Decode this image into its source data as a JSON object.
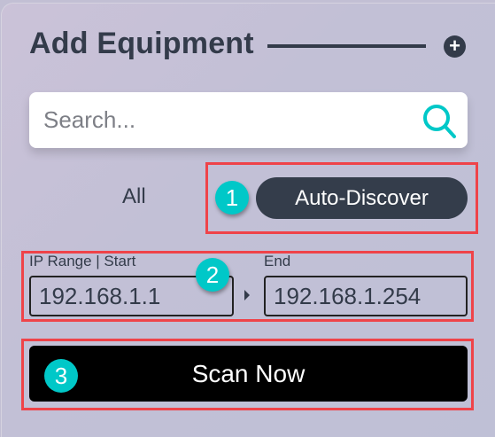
{
  "header": {
    "title": "Add Equipment",
    "add_icon": "plus-circle-icon"
  },
  "search": {
    "placeholder": "Search...",
    "icon": "search-icon",
    "accent": "#00c8c8"
  },
  "filters": {
    "all_label": "All",
    "auto_discover_label": "Auto-Discover"
  },
  "ip_range": {
    "start_label": "IP Range | Start",
    "start_value": "192.168.1.1",
    "end_label": "End",
    "end_value": "192.168.1.254"
  },
  "scan_button": {
    "label": "Scan Now"
  },
  "annotations": {
    "badge1": "1",
    "badge2": "2",
    "badge3": "3",
    "highlight_color": "#ef4349"
  }
}
